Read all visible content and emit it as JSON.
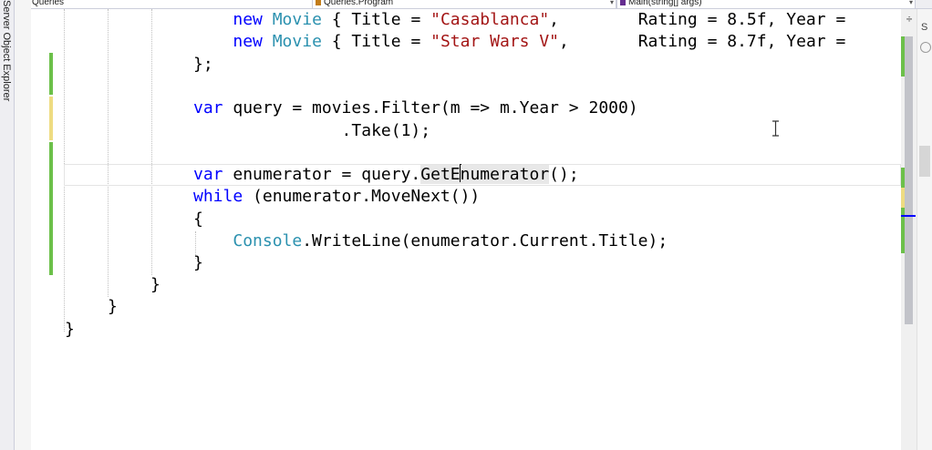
{
  "side_panel": {
    "label": "Server Object Explorer"
  },
  "navigation_bar": {
    "project_dropdown": "Queries",
    "class_dropdown": "Queries.Program",
    "member_dropdown": "Main(string[] args)"
  },
  "editor": {
    "lines": [
      {
        "tokens": [
          [
            "p",
            "    "
          ],
          [
            "kw",
            "new"
          ],
          [
            "p",
            " "
          ],
          [
            "ty",
            "Movie"
          ],
          [
            "p",
            " { Title = "
          ],
          [
            "st",
            "\"Casablanca\""
          ],
          [
            "p",
            ",        Rating = 8.5f, Year = "
          ]
        ]
      },
      {
        "tokens": [
          [
            "p",
            "    "
          ],
          [
            "kw",
            "new"
          ],
          [
            "p",
            " "
          ],
          [
            "ty",
            "Movie"
          ],
          [
            "p",
            " { Title = "
          ],
          [
            "st",
            "\"Star Wars V\""
          ],
          [
            "p",
            ",       Rating = 8.7f, Year = "
          ]
        ]
      },
      {
        "tokens": [
          [
            "p",
            "};"
          ]
        ]
      },
      {
        "tokens": []
      },
      {
        "tokens": [
          [
            "kw",
            "var"
          ],
          [
            "p",
            " query = movies.Filter(m => m.Year > 2000)"
          ]
        ]
      },
      {
        "tokens": [
          [
            "p",
            "               .Take(1);"
          ]
        ]
      },
      {
        "tokens": []
      },
      {
        "tokens": [
          [
            "kw",
            "var"
          ],
          [
            "p",
            " enumerator = query."
          ],
          [
            "hl1",
            "GetE"
          ],
          [
            "caret",
            ""
          ],
          [
            "hl2",
            "numerator"
          ],
          [
            "p",
            "();"
          ]
        ]
      },
      {
        "tokens": [
          [
            "kw",
            "while"
          ],
          [
            "p",
            " (enumerator.MoveNext())"
          ]
        ]
      },
      {
        "tokens": [
          [
            "p",
            "{"
          ]
        ]
      },
      {
        "tokens": [
          [
            "p",
            "    "
          ],
          [
            "ty",
            "Console"
          ],
          [
            "p",
            ".WriteLine(enumerator.Current.Title);"
          ]
        ]
      },
      {
        "tokens": [
          [
            "p",
            "}"
          ]
        ]
      }
    ],
    "closing_1": "}",
    "closing_2": "}",
    "closing_3": "}"
  },
  "colors": {
    "keyword": "#0000ff",
    "type": "#2b91af",
    "string": "#a31515",
    "change_saved": "#6cc04a",
    "change_unsaved": "#eedc82"
  }
}
